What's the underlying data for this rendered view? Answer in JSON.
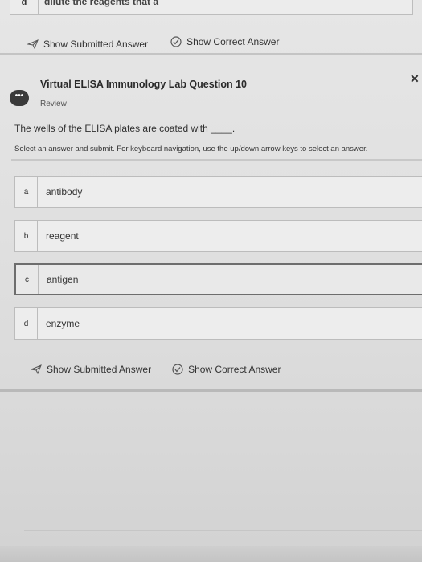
{
  "previous_question": {
    "option_letter": "d",
    "option_text": "dilute the reagents that a"
  },
  "top_actions": {
    "show_submitted": "Show Submitted Answer",
    "show_correct": "Show Correct Answer"
  },
  "question": {
    "icon_text": "•••",
    "title": "Virtual ELISA Immunology Lab Question 10",
    "subtitle": "Review",
    "prompt": "The wells of the ELISA plates are coated with ____.",
    "instructions": "Select an answer and submit. For keyboard navigation, use the up/down arrow keys to select an answer."
  },
  "options": [
    {
      "letter": "a",
      "text": "antibody"
    },
    {
      "letter": "b",
      "text": "reagent"
    },
    {
      "letter": "c",
      "text": "antigen"
    },
    {
      "letter": "d",
      "text": "enzyme"
    }
  ],
  "selected_option": "c",
  "bottom_actions": {
    "show_submitted": "Show Submitted Answer",
    "show_correct": "Show Correct Answer"
  },
  "colors": {
    "background": "#e2e2e2",
    "selected_border": "#6d6d6d",
    "text": "#333333"
  },
  "icons": {
    "submitted": "paper-plane-icon",
    "correct": "check-circle-icon",
    "close": "close-icon",
    "chat": "chat-bubble-icon"
  }
}
